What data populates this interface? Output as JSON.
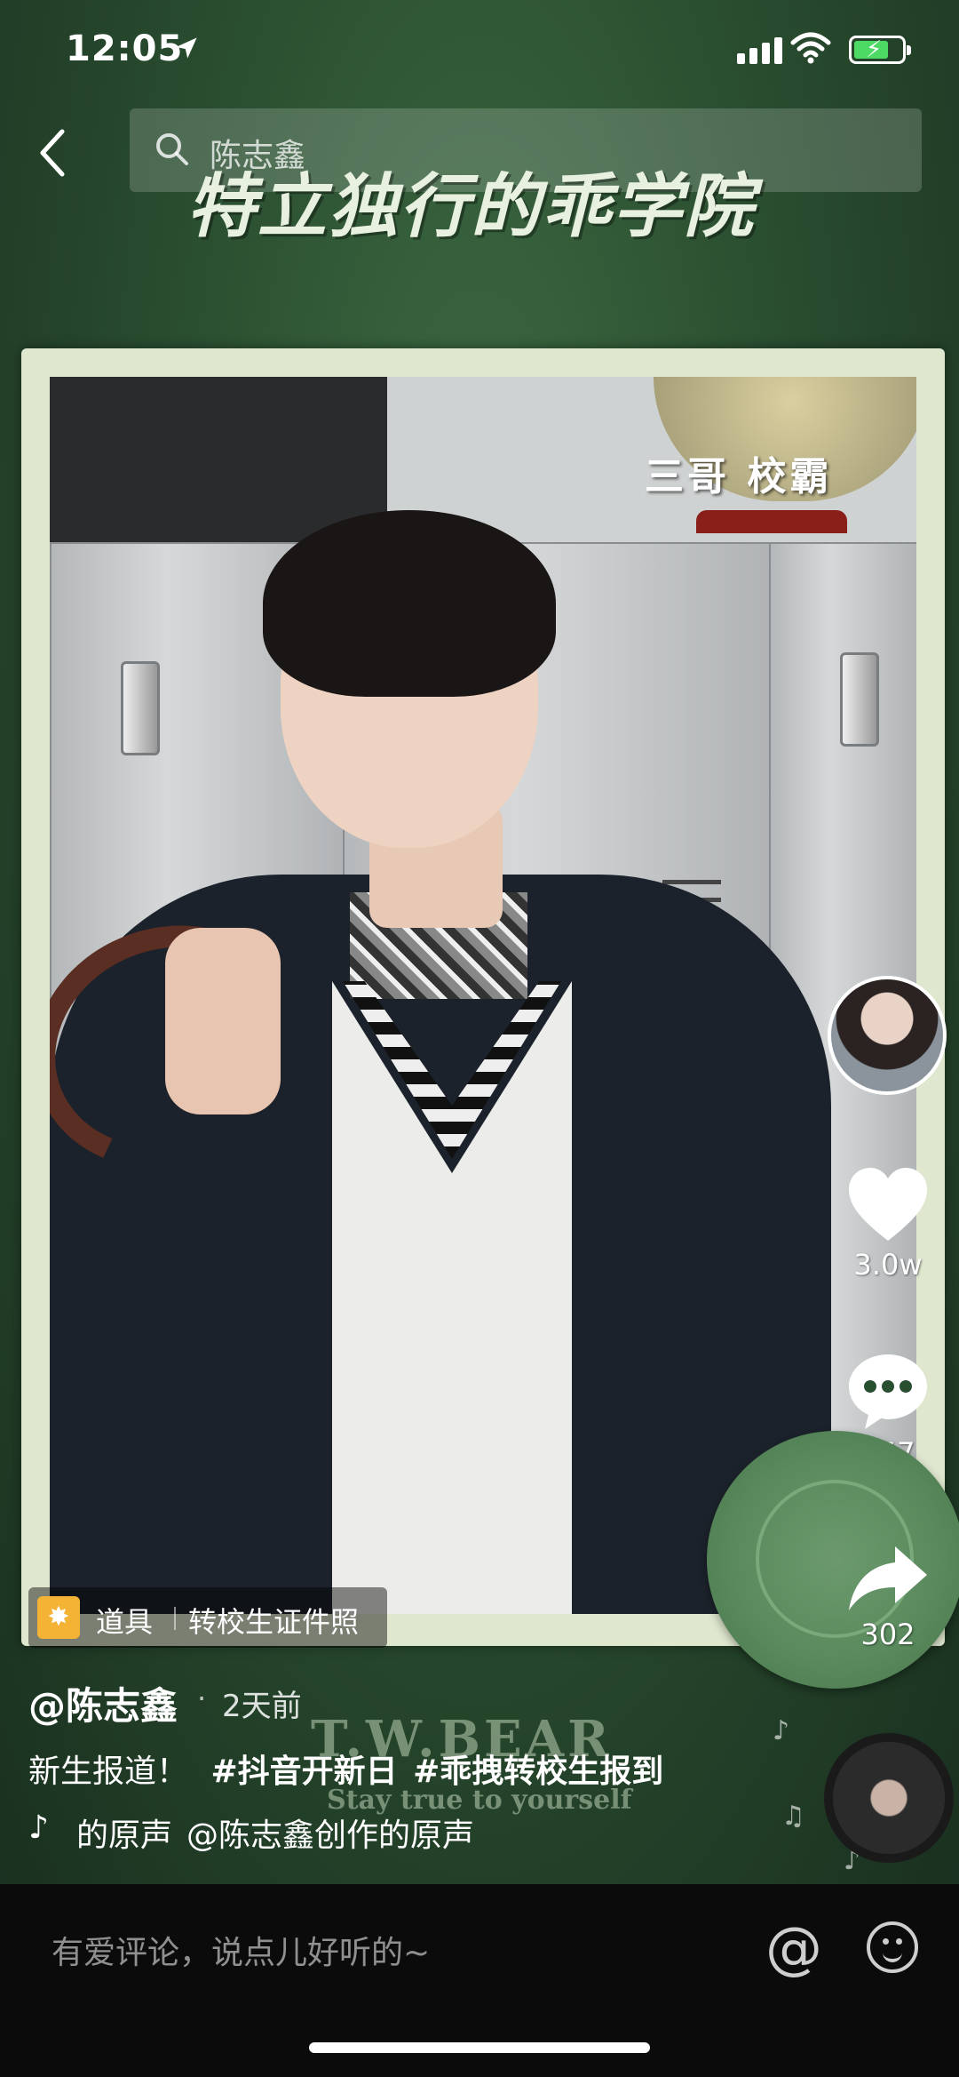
{
  "status_bar": {
    "time": "12:05"
  },
  "search": {
    "query": "陈志鑫"
  },
  "video": {
    "banner_title": "特立独行的乖学院",
    "overlay_caption": "三哥  校霸",
    "watermark_brand": "T.W.BEAR",
    "watermark_slogan": "Stay true to yourself"
  },
  "rail": {
    "likes": "3.0w",
    "comments": "657",
    "shares": "302"
  },
  "props": {
    "label": "道具",
    "name": "转校生证件照"
  },
  "post": {
    "author": "@陈志鑫",
    "time_ago": "2天前",
    "text": "新生报道！",
    "hashtags": [
      "#抖音开新日",
      "#乖拽转校生报到"
    ],
    "music_prefix": "的原声",
    "music_title": "@陈志鑫创作的原声"
  },
  "comment_bar": {
    "placeholder": "有爱评论，说点儿好听的~"
  },
  "colors": {
    "accent_green": "#2a4e30",
    "battery": "#4cd964",
    "props_icon": "#f5b335"
  }
}
